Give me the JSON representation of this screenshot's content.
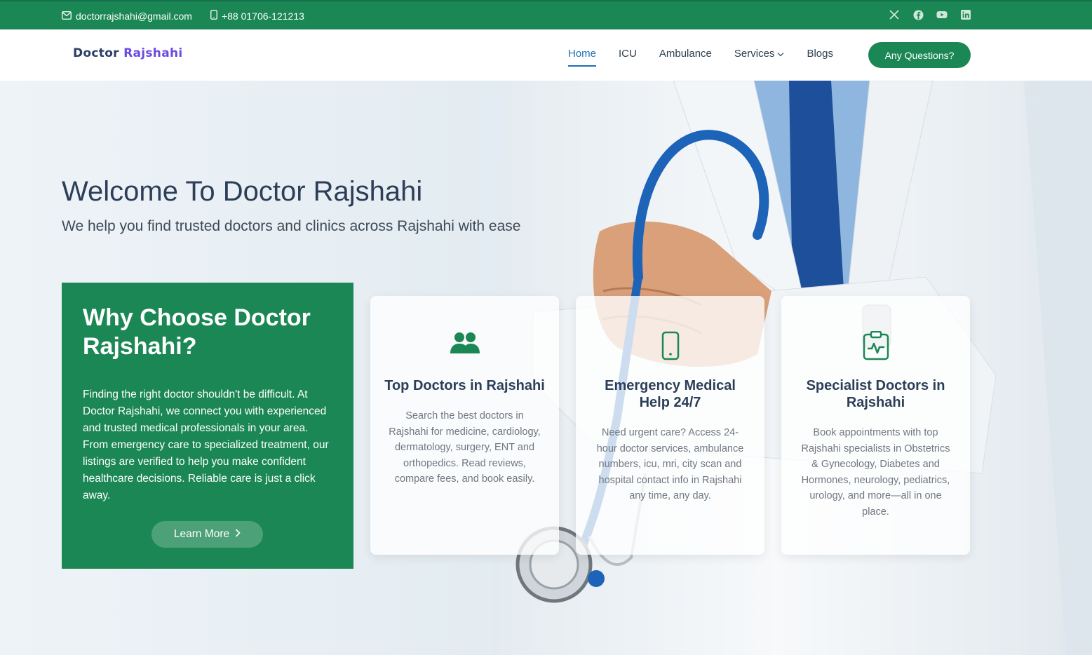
{
  "topbar": {
    "email": "doctorrajshahi@gmail.com",
    "phone": "+88 01706-121213",
    "social": [
      "x-icon",
      "facebook-icon",
      "youtube-icon",
      "linkedin-icon"
    ]
  },
  "header": {
    "logo_part1": "Doctor",
    "logo_part2": "Rajshahi",
    "nav": [
      {
        "label": "Home",
        "active": true
      },
      {
        "label": "ICU"
      },
      {
        "label": "Ambulance"
      },
      {
        "label": "Services",
        "dropdown": true
      },
      {
        "label": "Blogs"
      }
    ],
    "cta": "Any Questions?"
  },
  "hero": {
    "title": "Welcome To Doctor Rajshahi",
    "subtitle": "We help you find trusted doctors and clinics across Rajshahi with ease"
  },
  "why": {
    "title": "Why Choose Doctor Rajshahi?",
    "body": "Finding the right doctor shouldn't be difficult. At Doctor Rajshahi, we connect you with experienced and trusted medical professionals in your area. From emergency care to specialized treatment, our listings are verified to help you make confident healthcare decisions. Reliable care is just a click away.",
    "button": "Learn More"
  },
  "cards": [
    {
      "icon": "people-icon",
      "title": "Top Doctors in Rajshahi",
      "text": "Search the best doctors in Rajshahi for medicine, cardiology, dermatology, surgery, ENT and orthopedics. Read reviews, compare fees, and book easily."
    },
    {
      "icon": "phone-icon",
      "title": "Emergency Medical Help 24/7",
      "text": "Need urgent care? Access 24-hour doctor services, ambulance numbers, icu, mri, city scan and hospital contact info in Rajshahi any time, any day."
    },
    {
      "icon": "clipboard-pulse-icon",
      "title": "Specialist Doctors in Rajshahi",
      "text": "Book appointments with top Rajshahi specialists in Obstetrics & Gynecology, Diabetes and Hormones, neurology, pediatrics, urology, and more—all in one place."
    }
  ],
  "colors": {
    "brand_green": "#1b8754",
    "nav_active": "#1f6fb5",
    "logo_accent": "#6c4be0"
  }
}
